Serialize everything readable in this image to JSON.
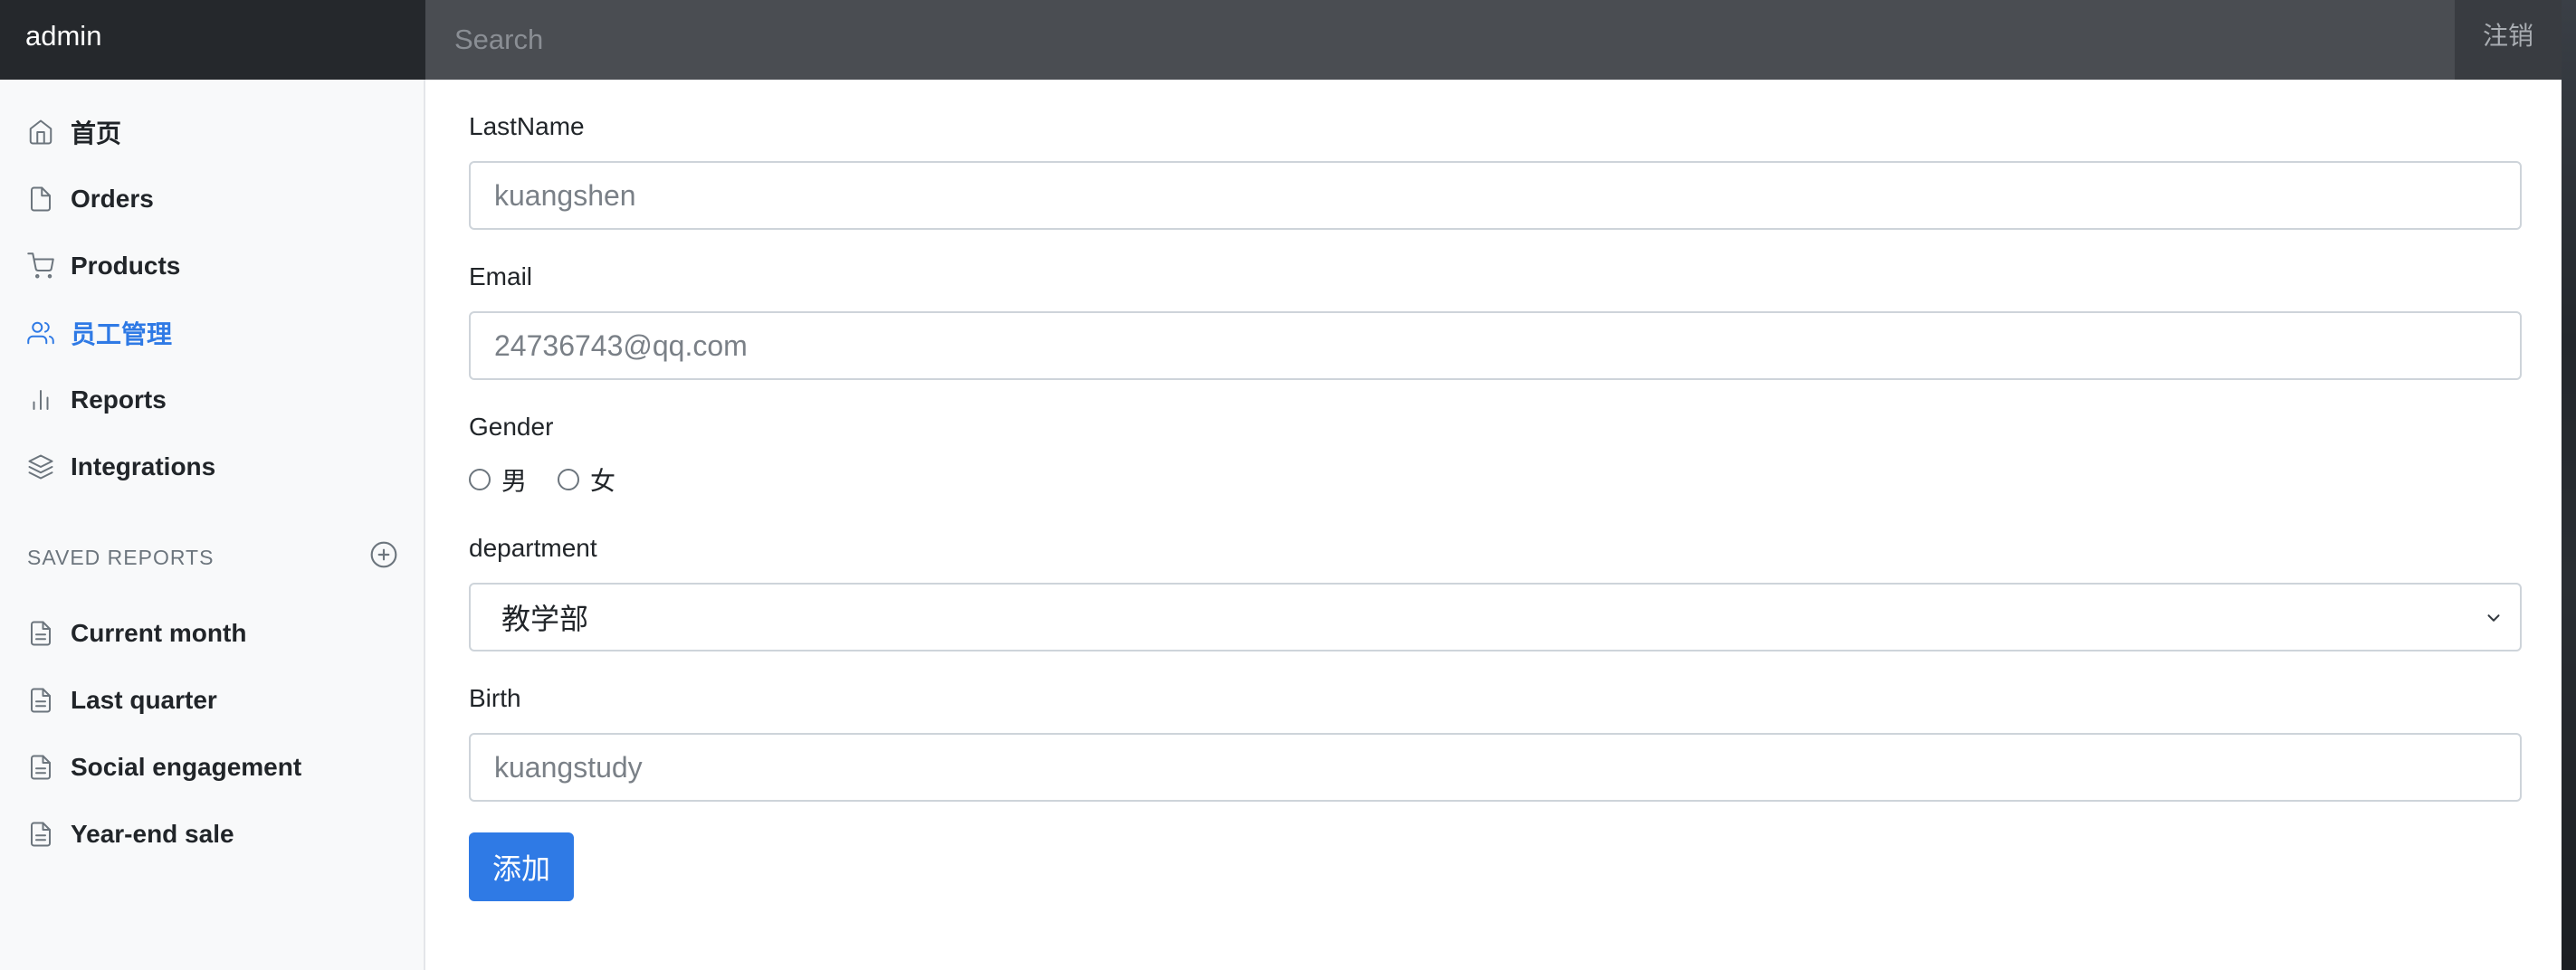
{
  "navbar": {
    "brand": "admin",
    "search_placeholder": "Search",
    "signout_label": "注销"
  },
  "sidebar": {
    "items": [
      {
        "label": "首页",
        "icon": "home-icon",
        "active": false
      },
      {
        "label": "Orders",
        "icon": "file-icon",
        "active": false
      },
      {
        "label": "Products",
        "icon": "shopping-cart-icon",
        "active": false
      },
      {
        "label": "员工管理",
        "icon": "users-icon",
        "active": true
      },
      {
        "label": "Reports",
        "icon": "bar-chart-icon",
        "active": false
      },
      {
        "label": "Integrations",
        "icon": "layers-icon",
        "active": false
      }
    ],
    "saved_reports_heading": "SAVED REPORTS",
    "saved_reports": [
      {
        "label": "Current month",
        "icon": "file-text-icon"
      },
      {
        "label": "Last quarter",
        "icon": "file-text-icon"
      },
      {
        "label": "Social engagement",
        "icon": "file-text-icon"
      },
      {
        "label": "Year-end sale",
        "icon": "file-text-icon"
      }
    ]
  },
  "form": {
    "lastname_label": "LastName",
    "lastname_placeholder": "kuangshen",
    "email_label": "Email",
    "email_placeholder": "24736743@qq.com",
    "gender_label": "Gender",
    "gender_options": [
      "男",
      "女"
    ],
    "department_label": "department",
    "department_selected": "教学部",
    "birth_label": "Birth",
    "birth_placeholder": "kuangstudy",
    "submit_label": "添加"
  },
  "colors": {
    "accent": "#2f7ae5",
    "navbar": "#4a4d52",
    "brand_bg": "#25282c",
    "sidebar_bg": "#f8f9fa"
  }
}
